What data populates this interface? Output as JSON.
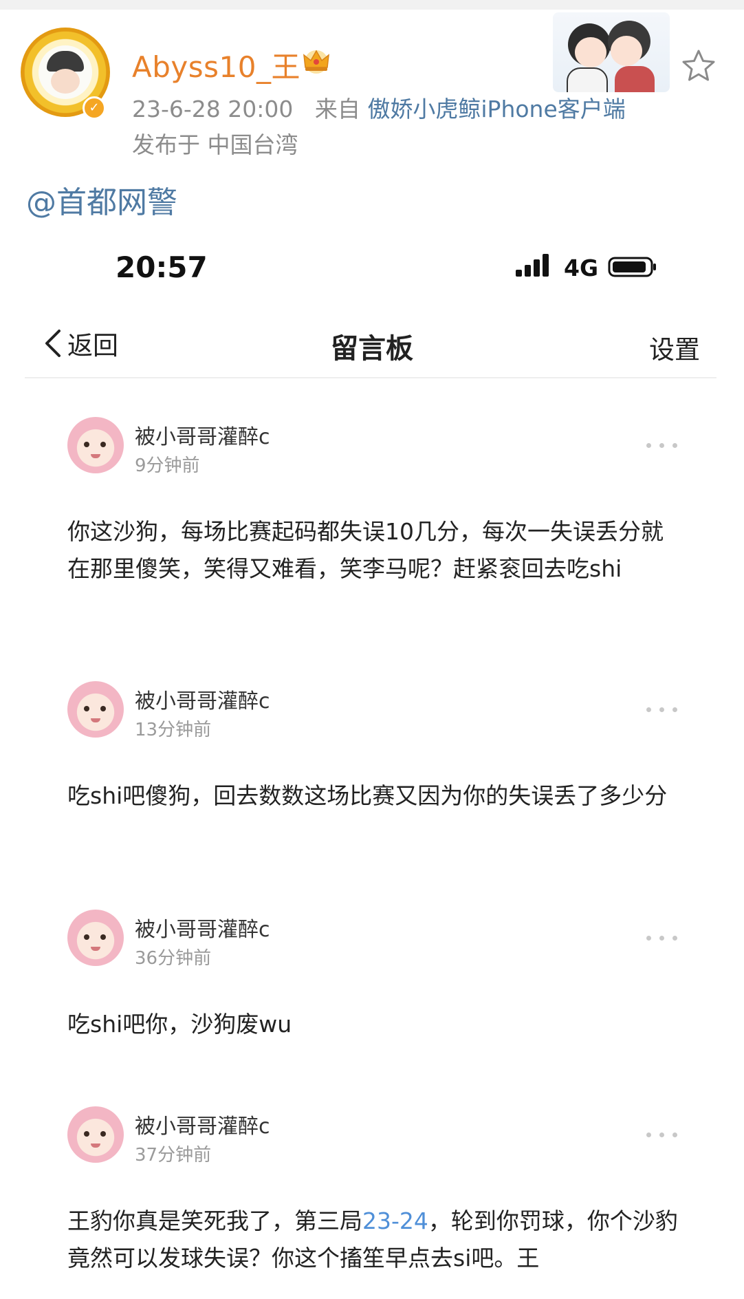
{
  "post": {
    "author": "Abyss10_王",
    "timestamp": "23-6-28 20:00",
    "source_prefix": "来自",
    "source": "傲娇小虎鲸iPhone客户端",
    "location": "发布于 中国台湾",
    "mention": "@首都网警",
    "icons": [
      "avatar",
      "verified-badge",
      "crown-icon",
      "sticker",
      "star-icon"
    ]
  },
  "phone": {
    "status_time": "20:57",
    "network": "4G",
    "back_label": "返回",
    "page_title": "留言板",
    "settings_label": "设置"
  },
  "messages": [
    {
      "author": "被小哥哥灌醉c",
      "time": "9分钟前",
      "text": "你这沙狗，每场比赛起码都失误10几分，每次一失误丢分就在那里傻笑，笑得又难看，笑李马呢？赶紧衮回去吃shi"
    },
    {
      "author": "被小哥哥灌醉c",
      "time": "13分钟前",
      "text": "吃shi吧傻狗，回去数数这场比赛又因为你的失误丢了多少分"
    },
    {
      "author": "被小哥哥灌醉c",
      "time": "36分钟前",
      "text": "吃shi吧你，沙狗废wu"
    },
    {
      "author": "被小哥哥灌醉c",
      "time": "37分钟前",
      "text_before": "王豹你真是笑死我了，第三局",
      "text_highlight": "23-24",
      "text_after": "，轮到你罚球，你个沙豹竟然可以发球失误？你这个搐笙早点去si吧。王"
    }
  ],
  "colors": {
    "author_orange": "#e8812b",
    "link_blue": "#4f7aa3",
    "score_blue": "#4f8fd8",
    "meta_gray": "#8c8c8c"
  }
}
